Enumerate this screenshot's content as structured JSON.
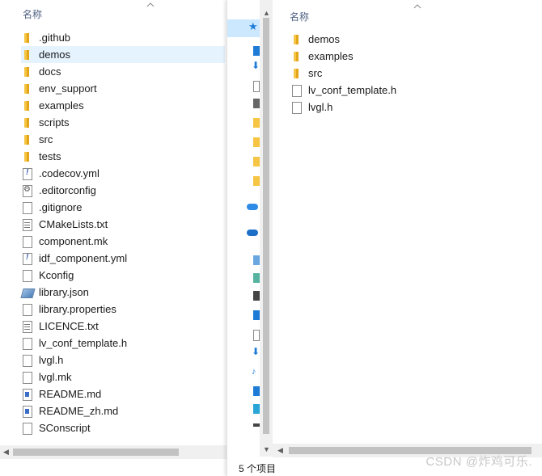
{
  "left": {
    "column_header": "名称",
    "items": [
      {
        "name": ".github",
        "type": "folder"
      },
      {
        "name": "demos",
        "type": "folder",
        "selected": true
      },
      {
        "name": "docs",
        "type": "folder"
      },
      {
        "name": "env_support",
        "type": "folder"
      },
      {
        "name": "examples",
        "type": "folder"
      },
      {
        "name": "scripts",
        "type": "folder"
      },
      {
        "name": "src",
        "type": "folder"
      },
      {
        "name": "tests",
        "type": "folder"
      },
      {
        "name": ".codecov.yml",
        "type": "yml"
      },
      {
        "name": ".editorconfig",
        "type": "gear"
      },
      {
        "name": ".gitignore",
        "type": "file"
      },
      {
        "name": "CMakeLists.txt",
        "type": "txt"
      },
      {
        "name": "component.mk",
        "type": "file"
      },
      {
        "name": "idf_component.yml",
        "type": "yml"
      },
      {
        "name": "Kconfig",
        "type": "file"
      },
      {
        "name": "library.json",
        "type": "json"
      },
      {
        "name": "library.properties",
        "type": "file"
      },
      {
        "name": "LICENCE.txt",
        "type": "txt"
      },
      {
        "name": "lv_conf_template.h",
        "type": "file"
      },
      {
        "name": "lvgl.h",
        "type": "file"
      },
      {
        "name": "lvgl.mk",
        "type": "file"
      },
      {
        "name": "README.md",
        "type": "md"
      },
      {
        "name": "README_zh.md",
        "type": "md"
      },
      {
        "name": "SConscript",
        "type": "file"
      }
    ]
  },
  "right": {
    "column_header": "名称",
    "items": [
      {
        "name": "demos",
        "type": "folder"
      },
      {
        "name": "examples",
        "type": "folder"
      },
      {
        "name": "src",
        "type": "folder"
      },
      {
        "name": "lv_conf_template.h",
        "type": "file"
      },
      {
        "name": "lvgl.h",
        "type": "file"
      }
    ],
    "status": "5 个项目"
  },
  "watermark": "CSDN @炸鸡可乐.",
  "colors": {
    "folder": "#f5c543",
    "selection": "#e5f3ff",
    "header_text": "#4d6082",
    "nav_accent": "#1e7bd6"
  }
}
